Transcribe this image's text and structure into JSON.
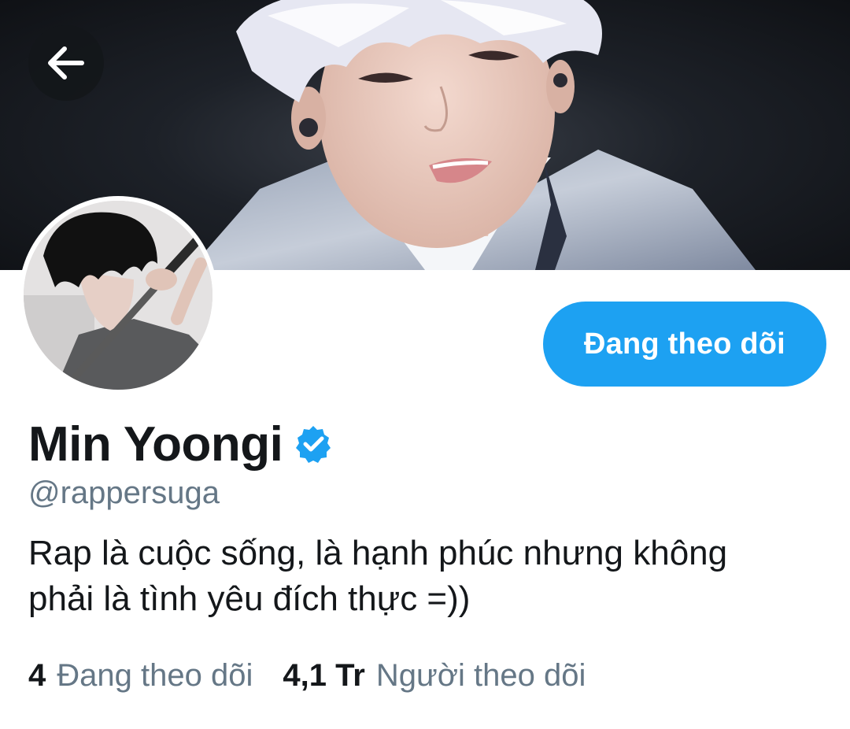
{
  "header": {
    "back_icon": "arrow-left-icon"
  },
  "profile": {
    "display_name": "Min Yoongi",
    "verified_icon": "verified-badge-icon",
    "handle": "@rappersuga",
    "bio_line1": "Rap là cuộc sống, là hạnh phúc nhưng không",
    "bio_line2": "phải là tình yêu đích thực =))",
    "follow_button_label": "Đang theo dõi"
  },
  "stats": {
    "following_count": "4",
    "following_label": "Đang theo dõi",
    "followers_count": "4,1 Tr",
    "followers_label": "Người theo dõi"
  },
  "colors": {
    "accent": "#1da1f2",
    "text_primary": "#14171a",
    "text_secondary": "#657786"
  }
}
